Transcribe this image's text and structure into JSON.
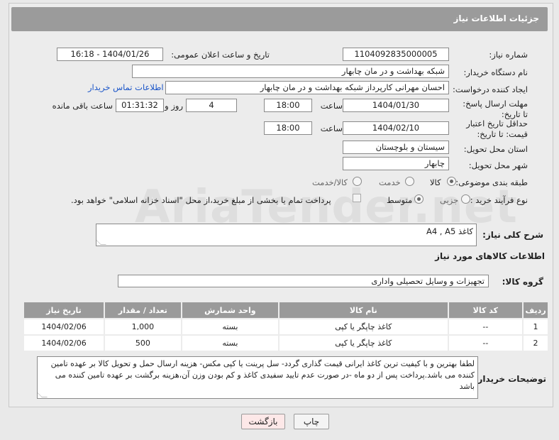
{
  "header": {
    "title": "جزئیات اطلاعات نیاز"
  },
  "fields": {
    "need_number_label": "شماره نیاز:",
    "need_number": "1104092835000005",
    "announce_label": "تاریخ و ساعت اعلان عمومی:",
    "announce_value": "1404/01/26 - 16:18",
    "buyer_label": "نام دستگاه خریدار:",
    "buyer_value": "شبکه بهداشت و در مان چابهار",
    "creator_label": "ایجاد کننده درخواست:",
    "creator_value": "احسان مهرانی کارپرداز شبکه بهداشت و در مان چابهار",
    "contact_link": "اطلاعات تماس خریدار",
    "deadline_label": "مهلت ارسال پاسخ: تا تاریخ:",
    "deadline_date": "1404/01/30",
    "time_label": "ساعت",
    "deadline_time": "18:00",
    "days_value": "4",
    "days_label": "روز و",
    "remaining_value": "01:31:32",
    "remaining_label": "ساعت باقی مانده",
    "validity_label": "حداقل تاریخ اعتبار قیمت: تا تاریخ:",
    "validity_date": "1404/02/10",
    "validity_time": "18:00",
    "province_label": "استان محل تحویل:",
    "province_value": "سیستان و بلوچستان",
    "city_label": "شهر محل تحویل:",
    "city_value": "چابهار",
    "category_label": "طبقه بندی موضوعی:",
    "category_options": [
      "کالا",
      "خدمت",
      "کالا/خدمت"
    ],
    "category_selected": "کالا",
    "process_label": "نوع فرآیند خرید :",
    "process_options": [
      "جزیی",
      "متوسط"
    ],
    "process_selected": "متوسط",
    "payment_note": "پرداخت تمام یا بخشی از مبلغ خرید،از محل \"اسناد خزانه اسلامی\" خواهد بود."
  },
  "summary": {
    "label": "شرح کلی نیاز:",
    "value": "کاغذ A4 , A5"
  },
  "goods": {
    "section_title": "اطلاعات کالاهای مورد نیاز",
    "group_label": "گروه کالا:",
    "group_value": "تجهیزات و وسایل تحصیلی واداری",
    "columns": [
      "ردیف",
      "کد کالا",
      "نام کالا",
      "واحد شمارش",
      "تعداد / مقدار",
      "تاریخ نیاز"
    ],
    "rows": [
      {
        "row": "1",
        "code": "--",
        "name": "کاغذ چاپگر یا کپی",
        "unit": "بسته",
        "qty": "1,000",
        "date": "1404/02/06"
      },
      {
        "row": "2",
        "code": "--",
        "name": "کاغذ چاپگر یا کپی",
        "unit": "بسته",
        "qty": "500",
        "date": "1404/02/06"
      }
    ]
  },
  "notes": {
    "label": "توضیحات خریدار:",
    "value": "لطفا بهترین و با کیفیت ترین کاغذ ایرانی قیمت گذاری گردد- سل پرینت یا کپی مکس- هزینه ارسال حمل و تحویل کالا بر عهده تامین کننده می باشد.پرداخت پس از دو ماه -در صورت عدم تایید سفیدی کاغذ و کم بودن وزن آن،هزینه برگشت بر عهده تامین کننده می باشد"
  },
  "buttons": {
    "print": "چاپ",
    "back": "بازگشت"
  },
  "watermark": "AriaTender.net",
  "colors": {
    "header_bg": "#9b9b9b",
    "link": "#1a55c8",
    "back_button_bg": "#fde8e8"
  }
}
